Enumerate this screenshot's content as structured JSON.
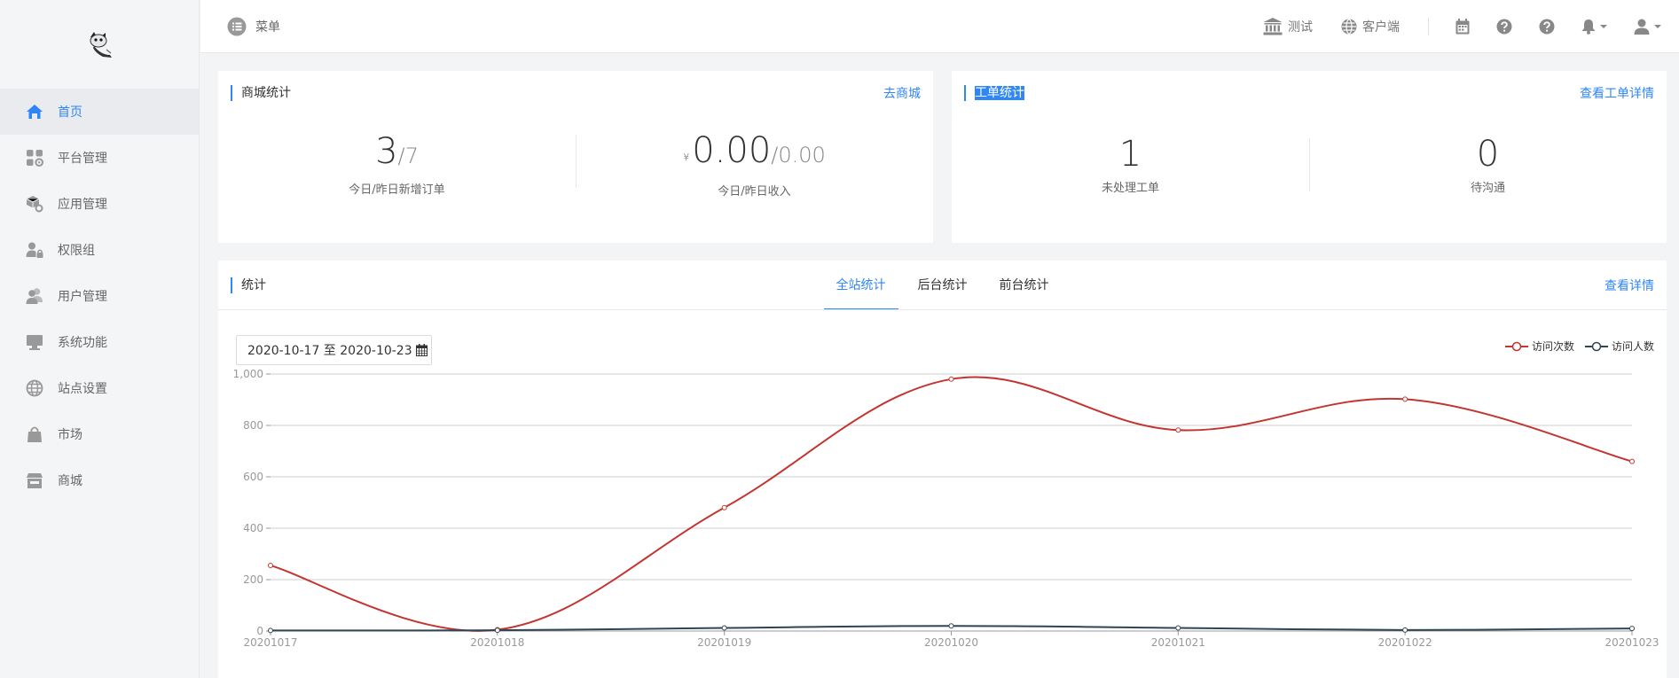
{
  "header": {
    "menu_label": "菜单",
    "link_test": "测试",
    "link_client": "客户端"
  },
  "sidebar": {
    "items": [
      {
        "label": "首页",
        "icon": "home-icon"
      },
      {
        "label": "平台管理",
        "icon": "apps-gear-icon"
      },
      {
        "label": "应用管理",
        "icon": "box-gear-icon"
      },
      {
        "label": "权限组",
        "icon": "user-lock-icon"
      },
      {
        "label": "用户管理",
        "icon": "users-icon"
      },
      {
        "label": "系统功能",
        "icon": "monitor-icon"
      },
      {
        "label": "站点设置",
        "icon": "globe-icon"
      },
      {
        "label": "市场",
        "icon": "bag-icon"
      },
      {
        "label": "商城",
        "icon": "store-icon"
      }
    ]
  },
  "mall_stats": {
    "title": "商城统计",
    "link": "去商城",
    "orders_today": "3",
    "orders_yesterday": "/7",
    "orders_label": "今日/昨日新增订单",
    "currency": "¥",
    "income_today": "0.00",
    "income_yesterday": "/0.00",
    "income_label": "今日/昨日收入"
  },
  "ticket_stats": {
    "title": "工单统计",
    "link": "查看工单详情",
    "unprocessed": "1",
    "unprocessed_label": "未处理工单",
    "pending": "0",
    "pending_label": "待沟通"
  },
  "stats_panel": {
    "title": "统计",
    "link": "查看详情",
    "tabs": [
      "全站统计",
      "后台统计",
      "前台统计"
    ],
    "date_range": "2020-10-17 至 2020-10-23"
  },
  "colors": {
    "accent": "#2f86f6",
    "visits": "#c23531",
    "visitors": "#2f4554"
  },
  "chart_data": {
    "type": "line",
    "x": [
      "20201017",
      "20201018",
      "20201019",
      "20201020",
      "20201021",
      "20201022",
      "20201023"
    ],
    "series": [
      {
        "name": "访问次数",
        "values": [
          255,
          5,
          480,
          980,
          782,
          902,
          660
        ]
      },
      {
        "name": "访问人数",
        "values": [
          2,
          3,
          12,
          20,
          12,
          4,
          10
        ]
      }
    ],
    "ylim": [
      0,
      1000
    ],
    "yticks": [
      "0",
      "200",
      "400",
      "600",
      "800",
      "1,000"
    ],
    "legend": "top-right",
    "grid": true
  }
}
